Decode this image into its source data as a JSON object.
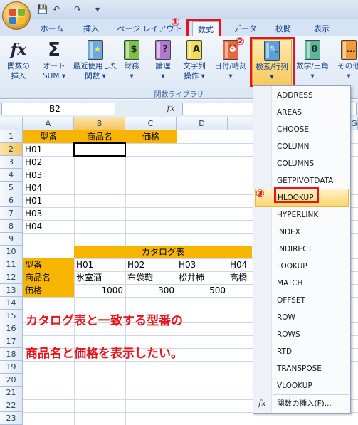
{
  "titlebar": {
    "quick_access": [
      "💾",
      "↶",
      "↷",
      "▾"
    ]
  },
  "tabs": [
    "ホーム",
    "挿入",
    "ページ レイアウト",
    "数式",
    "データ",
    "校閲",
    "表示"
  ],
  "active_tab": "数式",
  "markers": [
    "①",
    "②",
    "③"
  ],
  "ribbon": {
    "buttons": [
      {
        "icon": "fx",
        "label1": "関数の",
        "label2": "挿入"
      },
      {
        "icon": "Σ",
        "label1": "オート",
        "label2": "SUM ▾"
      },
      {
        "icon": "★",
        "label1": "最近使用した",
        "label2": "関数 ▾"
      },
      {
        "icon": "$",
        "label1": "財務",
        "label2": "▾"
      },
      {
        "icon": "?",
        "label1": "論理",
        "label2": "▾"
      },
      {
        "icon": "A",
        "label1": "文字列",
        "label2": "操作 ▾"
      },
      {
        "icon": "⏰",
        "label1": "日付/時刻",
        "label2": "▾"
      },
      {
        "icon": "🔍",
        "label1": "検索/行列",
        "label2": "▾"
      },
      {
        "icon": "θ",
        "label1": "数学/三角",
        "label2": "▾"
      },
      {
        "icon": "…",
        "label1": "その他",
        "label2": "▾"
      }
    ],
    "group_label": "関数ライブラリ"
  },
  "formula_bar": {
    "name_box": "B2",
    "fx": "fx"
  },
  "grid": {
    "columns": [
      "A",
      "B",
      "C",
      "D",
      "G"
    ],
    "rows": [
      "1",
      "2",
      "3",
      "4",
      "5",
      "6",
      "7",
      "8",
      "9",
      "10",
      "11",
      "12",
      "13",
      "14",
      "15",
      "16",
      "17",
      "18",
      "19",
      "20",
      "21",
      "22",
      "23"
    ],
    "header_row": [
      "型番",
      "商品名",
      "価格"
    ],
    "col_a_values": [
      "H01",
      "H02",
      "H03",
      "H04",
      "H01",
      "H03",
      "H04"
    ],
    "catalog_title": "カタログ表",
    "catalog_row_labels": [
      "型番",
      "商品名",
      "価格"
    ],
    "catalog_codes": [
      "H01",
      "H02",
      "H03",
      "H04"
    ],
    "catalog_names": [
      "氷室酒",
      "布袋鞄",
      "松井柿",
      "高橋"
    ],
    "catalog_prices": [
      "1000",
      "300",
      "500"
    ],
    "note_line1": "カタログ表と一致する型番の",
    "note_line2": "商品名と価格を表示したい。"
  },
  "menu": {
    "items": [
      "ADDRESS",
      "AREAS",
      "CHOOSE",
      "COLUMN",
      "COLUMNS",
      "GETPIVOTDATA",
      "HLOOKUP",
      "HYPERLINK",
      "INDEX",
      "INDIRECT",
      "LOOKUP",
      "MATCH",
      "OFFSET",
      "ROW",
      "ROWS",
      "RTD",
      "TRANSPOSE",
      "VLOOKUP"
    ],
    "highlighted": "HLOOKUP",
    "insert_function": "関数の挿入(F)..."
  },
  "colors": {
    "accent_red": "#e8141b",
    "header_orange": "#f7b500"
  }
}
